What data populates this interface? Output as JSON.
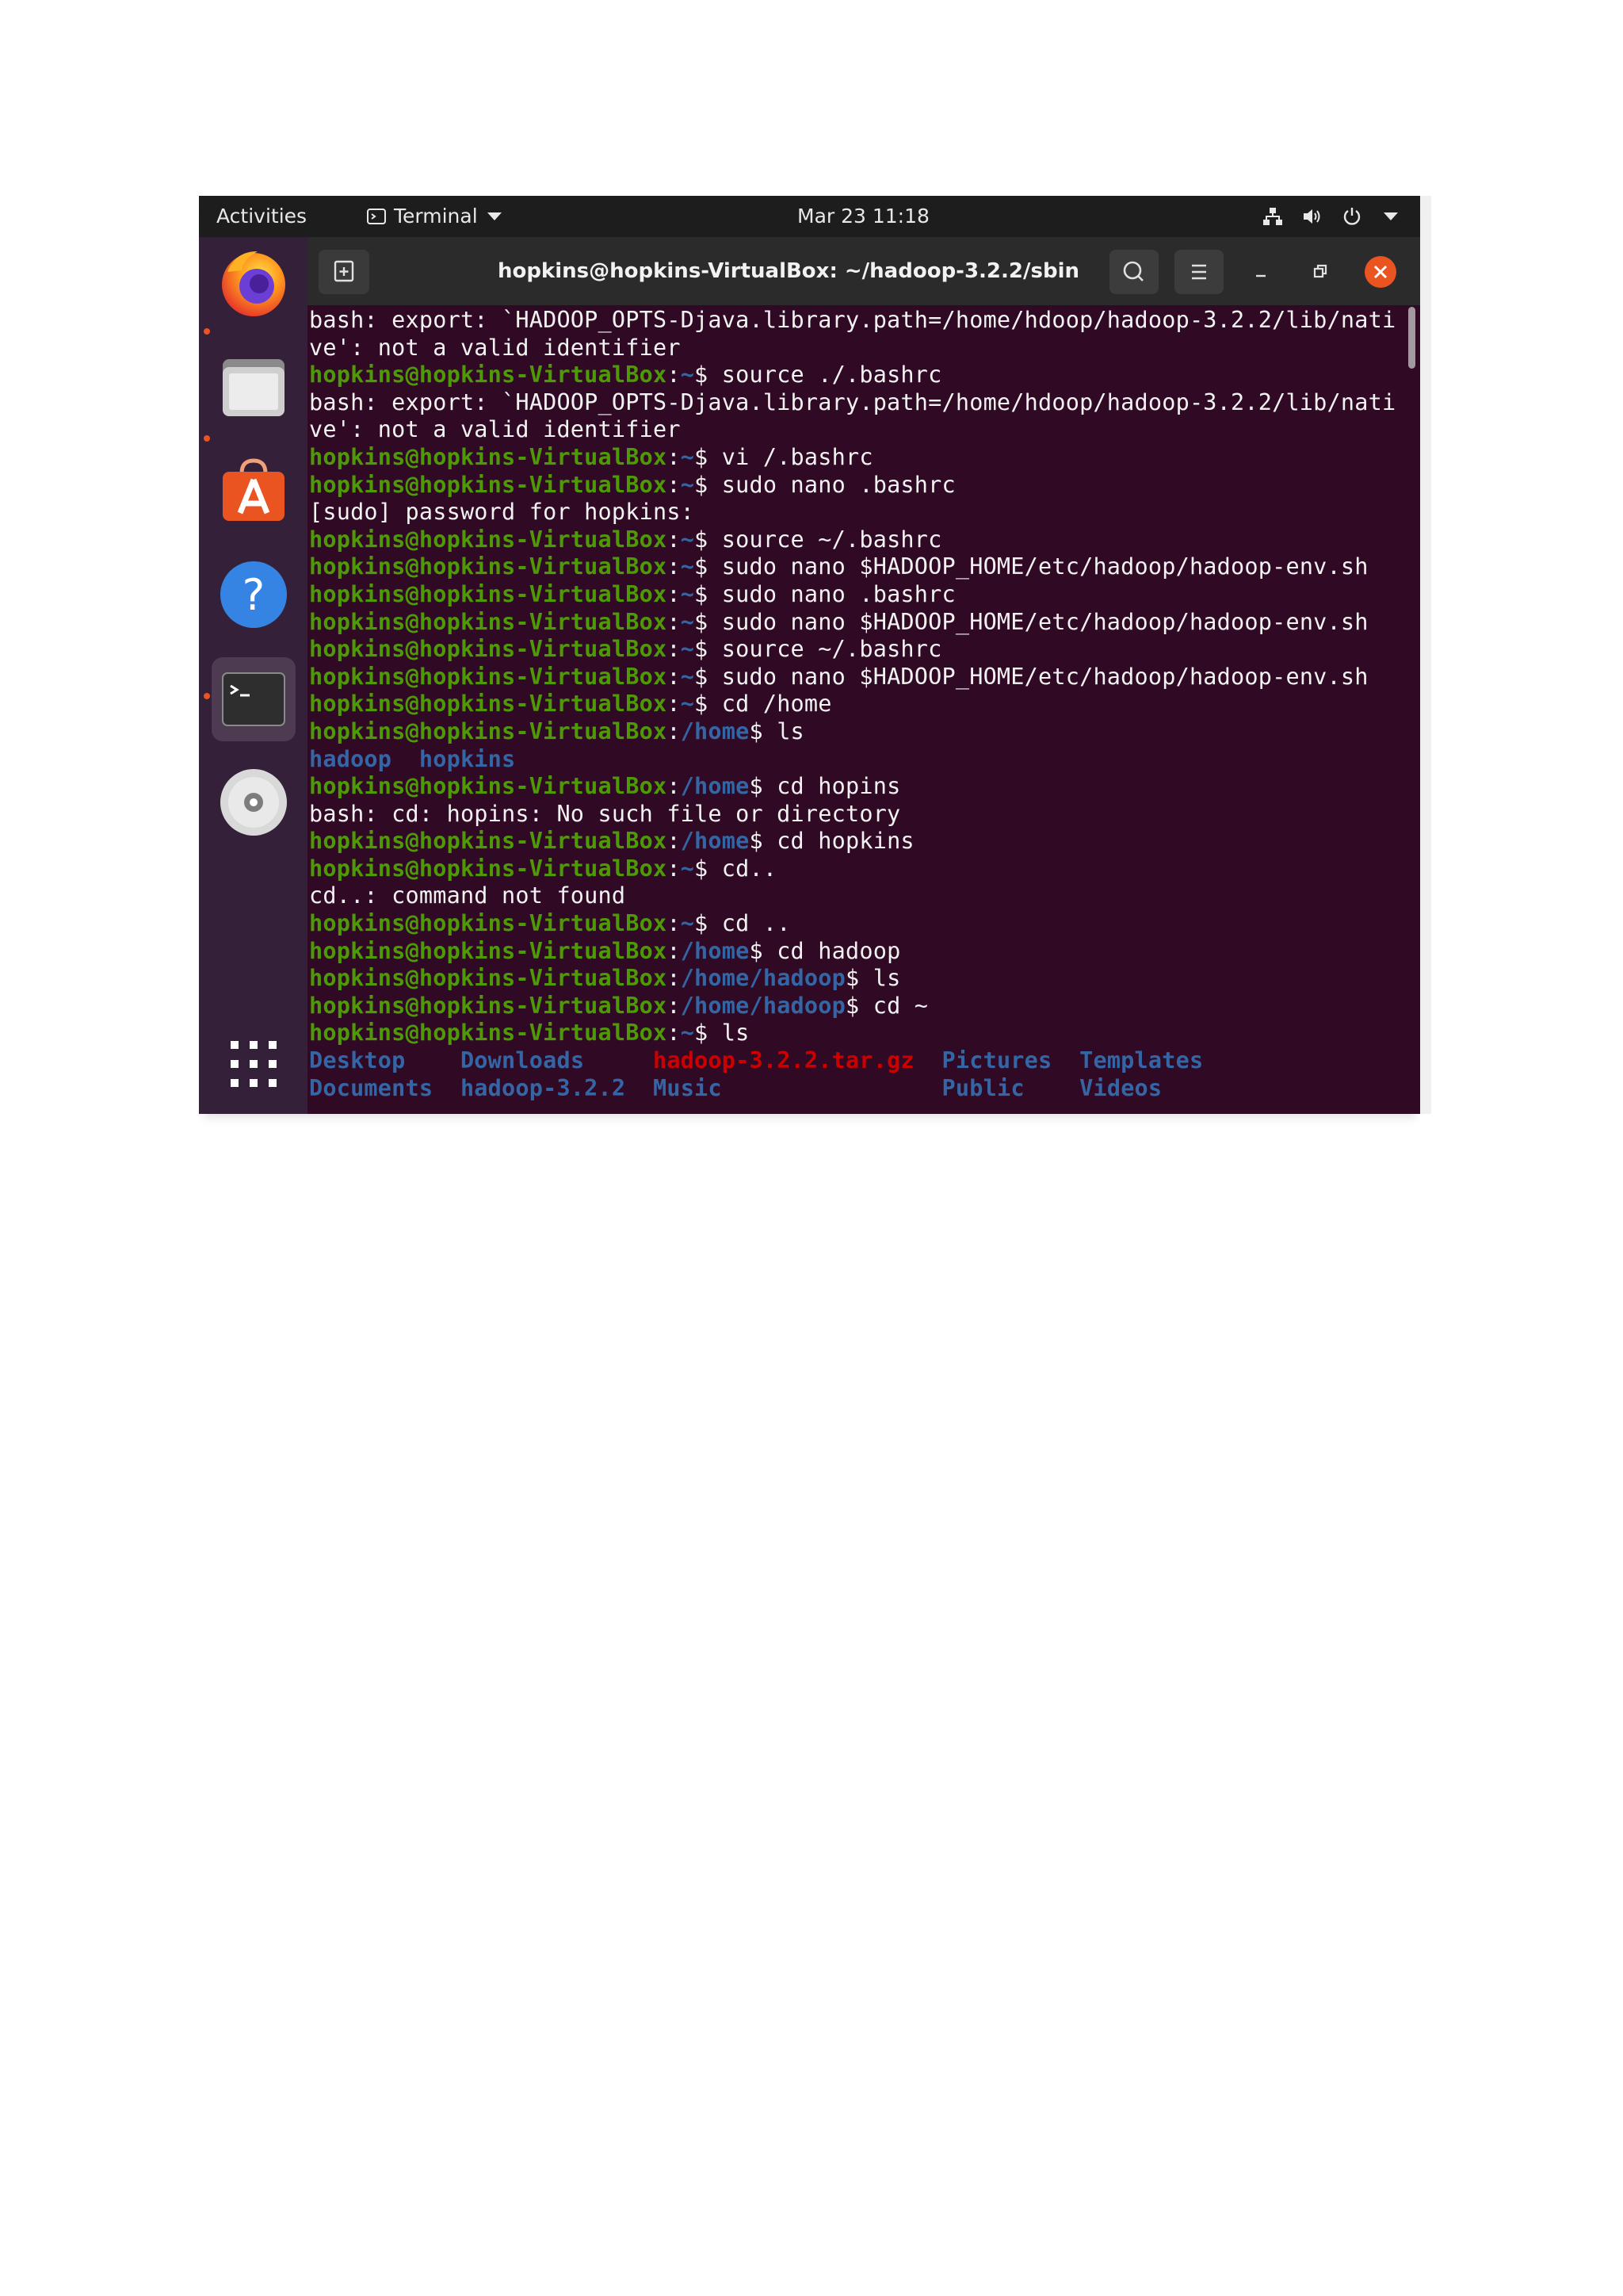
{
  "topbar": {
    "activities": "Activities",
    "app_menu": "Terminal",
    "clock": "Mar 23  11:18"
  },
  "dock": {
    "items": [
      {
        "name": "Firefox",
        "icon": "firefox-icon",
        "running": true
      },
      {
        "name": "Files",
        "icon": "files-icon",
        "running": true
      },
      {
        "name": "Ubuntu Software",
        "icon": "software-center-icon",
        "running": false
      },
      {
        "name": "Help",
        "icon": "help-icon",
        "running": false
      },
      {
        "name": "Terminal",
        "icon": "terminal-icon",
        "running": true,
        "active": true
      },
      {
        "name": "Optical Disc",
        "icon": "disc-icon",
        "running": false
      },
      {
        "name": "Show Applications",
        "icon": "app-grid-icon",
        "running": false
      }
    ]
  },
  "window": {
    "title": "hopkins@hopkins-VirtualBox: ~/hadoop-3.2.2/sbin"
  },
  "terminal": {
    "prompt_user": "hopkins@hopkins-VirtualBox",
    "lines": [
      {
        "type": "text",
        "text": "bash: export: `HADOOP_OPTS-Djava.library.path=/home/hdoop/hadoop-3.2.2/lib/nati"
      },
      {
        "type": "text",
        "text": "ve': not a valid identifier"
      },
      {
        "type": "prompt",
        "path": "~",
        "cmd": " source ./.bashrc"
      },
      {
        "type": "text",
        "text": "bash: export: `HADOOP_OPTS-Djava.library.path=/home/hdoop/hadoop-3.2.2/lib/nati"
      },
      {
        "type": "text",
        "text": "ve': not a valid identifier"
      },
      {
        "type": "prompt",
        "path": "~",
        "cmd": " vi /.bashrc"
      },
      {
        "type": "prompt",
        "path": "~",
        "cmd": " sudo nano .bashrc"
      },
      {
        "type": "text",
        "text": "[sudo] password for hopkins:"
      },
      {
        "type": "prompt",
        "path": "~",
        "cmd": " source ~/.bashrc"
      },
      {
        "type": "prompt",
        "path": "~",
        "cmd": " sudo nano $HADOOP_HOME/etc/hadoop/hadoop-env.sh"
      },
      {
        "type": "prompt",
        "path": "~",
        "cmd": " sudo nano .bashrc"
      },
      {
        "type": "prompt",
        "path": "~",
        "cmd": " sudo nano $HADOOP_HOME/etc/hadoop/hadoop-env.sh"
      },
      {
        "type": "prompt",
        "path": "~",
        "cmd": " source ~/.bashrc"
      },
      {
        "type": "prompt",
        "path": "~",
        "cmd": " sudo nano $HADOOP_HOME/etc/hadoop/hadoop-env.sh"
      },
      {
        "type": "prompt",
        "path": "~",
        "cmd": " cd /home"
      },
      {
        "type": "prompt",
        "path": "/home",
        "cmd": " ls"
      },
      {
        "type": "ls",
        "entries": [
          {
            "name": "hadoop",
            "kind": "dir",
            "col": 0
          },
          {
            "name": "hopkins",
            "kind": "dir",
            "col": 8
          }
        ]
      },
      {
        "type": "prompt",
        "path": "/home",
        "cmd": " cd hopins"
      },
      {
        "type": "text",
        "text": "bash: cd: hopins: No such file or directory"
      },
      {
        "type": "prompt",
        "path": "/home",
        "cmd": " cd hopkins"
      },
      {
        "type": "prompt",
        "path": "~",
        "cmd": " cd.."
      },
      {
        "type": "text",
        "text": "cd..: command not found"
      },
      {
        "type": "prompt",
        "path": "~",
        "cmd": " cd .."
      },
      {
        "type": "prompt",
        "path": "/home",
        "cmd": " cd hadoop"
      },
      {
        "type": "prompt",
        "path": "/home/hadoop",
        "cmd": " ls"
      },
      {
        "type": "prompt",
        "path": "/home/hadoop",
        "cmd": " cd ~"
      },
      {
        "type": "prompt",
        "path": "~",
        "cmd": " ls"
      },
      {
        "type": "ls",
        "entries": [
          {
            "name": "Desktop",
            "kind": "dir",
            "col": 0
          },
          {
            "name": "Downloads",
            "kind": "dir",
            "col": 11
          },
          {
            "name": "hadoop-3.2.2.tar.gz",
            "kind": "archive",
            "col": 25
          },
          {
            "name": "Pictures",
            "kind": "dir",
            "col": 46
          },
          {
            "name": "Templates",
            "kind": "dir",
            "col": 56
          }
        ]
      },
      {
        "type": "ls",
        "entries": [
          {
            "name": "Documents",
            "kind": "dir",
            "col": 0
          },
          {
            "name": "hadoop-3.2.2",
            "kind": "dir",
            "col": 11
          },
          {
            "name": "Music",
            "kind": "dir",
            "col": 25
          },
          {
            "name": "Public",
            "kind": "dir",
            "col": 46
          },
          {
            "name": "Videos",
            "kind": "dir",
            "col": 56
          }
        ]
      }
    ]
  },
  "colors": {
    "terminal_bg": "#300a24",
    "prompt_user": "#4e9a06",
    "prompt_path": "#3465a4",
    "archive": "#cc0000",
    "accent": "#e95420"
  }
}
